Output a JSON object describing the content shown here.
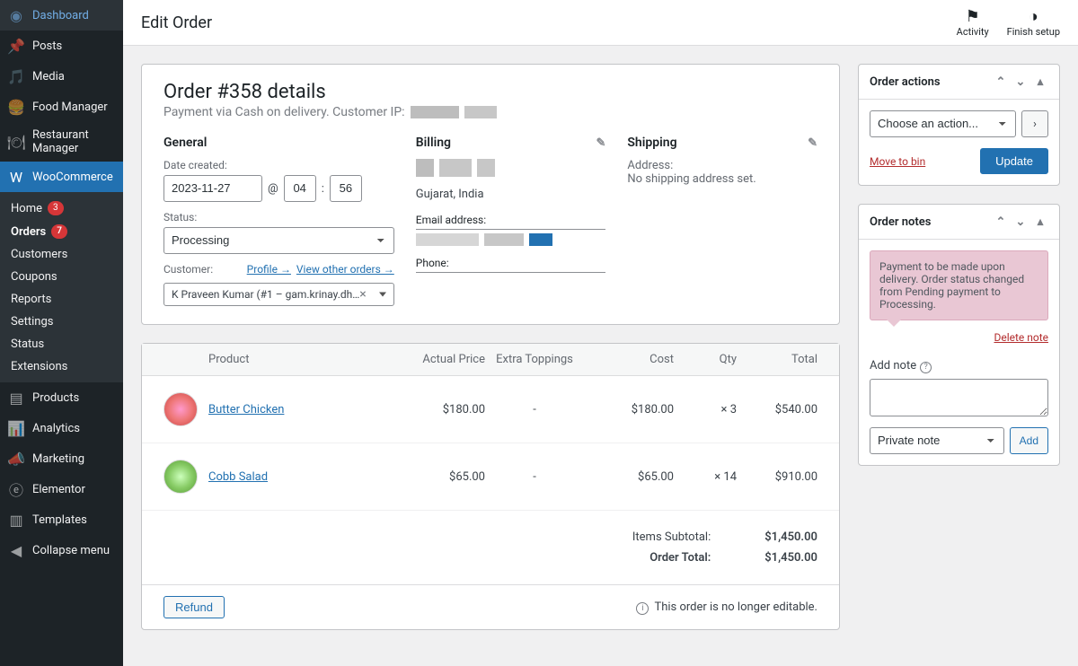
{
  "page_title": "Edit Order",
  "topbar": {
    "activity": "Activity",
    "finish_setup": "Finish setup"
  },
  "sidebar": {
    "items": [
      {
        "label": "Dashboard"
      },
      {
        "label": "Posts"
      },
      {
        "label": "Media"
      },
      {
        "label": "Food Manager"
      },
      {
        "label": "Restaurant Manager"
      },
      {
        "label": "WooCommerce"
      },
      {
        "label": "Products"
      },
      {
        "label": "Analytics"
      },
      {
        "label": "Marketing"
      },
      {
        "label": "Elementor"
      },
      {
        "label": "Templates"
      },
      {
        "label": "Collapse menu"
      }
    ],
    "submenu": [
      {
        "label": "Home",
        "badge": "3"
      },
      {
        "label": "Orders",
        "badge": "7"
      },
      {
        "label": "Customers"
      },
      {
        "label": "Coupons"
      },
      {
        "label": "Reports"
      },
      {
        "label": "Settings"
      },
      {
        "label": "Status"
      },
      {
        "label": "Extensions"
      }
    ]
  },
  "order": {
    "title": "Order #358 details",
    "subtitle": "Payment via Cash on delivery. Customer IP:",
    "general": {
      "heading": "General",
      "date_created_label": "Date created:",
      "date": "2023-11-27",
      "at": "@",
      "hour": "04",
      "colon": ":",
      "minute": "56",
      "status_label": "Status:",
      "status": "Processing",
      "customer_label": "Customer:",
      "profile_link": "Profile →",
      "view_orders_link": "View other orders →",
      "customer_value": "K Praveen Kumar (#1 – gam.krinay.dh…"
    },
    "billing": {
      "heading": "Billing",
      "region": "Gujarat, India",
      "email_label": "Email address:",
      "phone_label": "Phone:"
    },
    "shipping": {
      "heading": "Shipping",
      "address_label": "Address:",
      "no_address": "No shipping address set."
    }
  },
  "items": {
    "headers": {
      "product": "Product",
      "actual_price": "Actual Price",
      "extra": "Extra Toppings",
      "cost": "Cost",
      "qty": "Qty",
      "total": "Total"
    },
    "rows": [
      {
        "name": "Butter Chicken",
        "actual_price": "$180.00",
        "extra": "-",
        "cost": "$180.00",
        "qty": "× 3",
        "total": "$540.00"
      },
      {
        "name": "Cobb Salad",
        "actual_price": "$65.00",
        "extra": "-",
        "cost": "$65.00",
        "qty": "× 14",
        "total": "$910.00"
      }
    ],
    "subtotal_label": "Items Subtotal:",
    "subtotal": "$1,450.00",
    "total_label": "Order Total:",
    "total": "$1,450.00",
    "refund_btn": "Refund",
    "not_editable": "This order is no longer editable."
  },
  "actions": {
    "title": "Order actions",
    "placeholder": "Choose an action...",
    "move_to_bin": "Move to bin",
    "update": "Update"
  },
  "notes": {
    "title": "Order notes",
    "note_text": "Payment to be made upon delivery. Order status changed from Pending payment to Processing.",
    "delete": "Delete note",
    "add_label": "Add note",
    "note_type": "Private note",
    "add_btn": "Add"
  }
}
